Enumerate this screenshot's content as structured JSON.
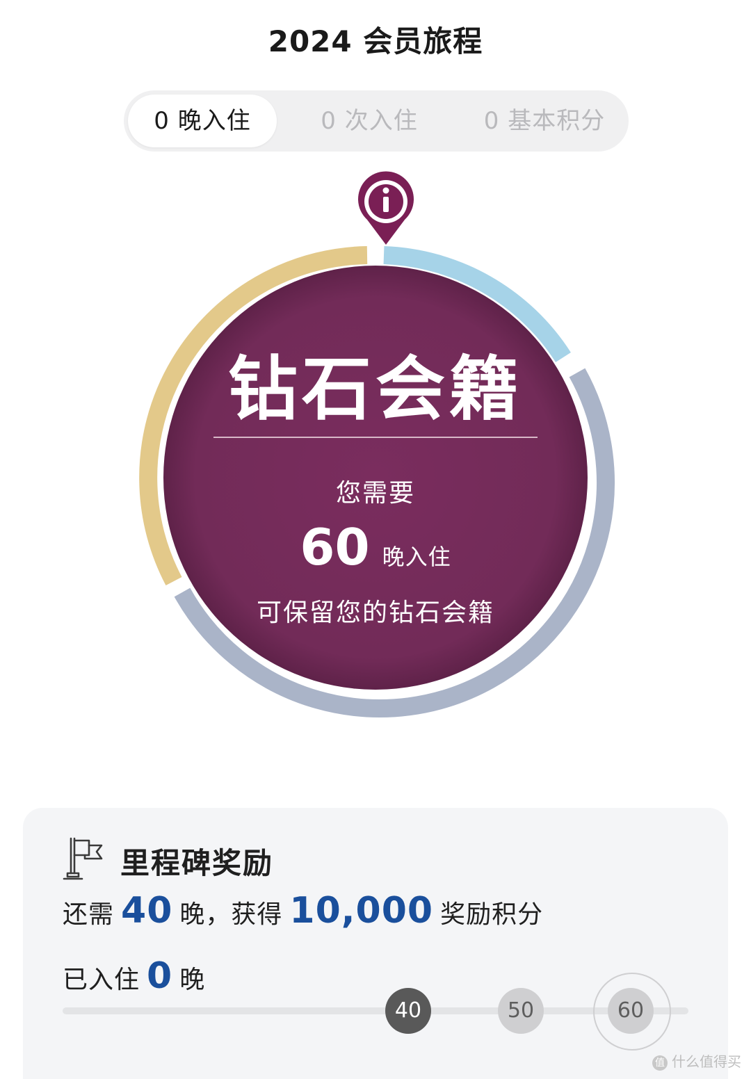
{
  "header": {
    "title": "2024 会员旅程"
  },
  "tabs": [
    {
      "label": "0 晚入住",
      "active": true
    },
    {
      "label": "0 次入住",
      "active": false
    },
    {
      "label": "0 基本积分",
      "active": false
    }
  ],
  "status_ring": {
    "info_icon": "info-pin-icon",
    "tier_name": "钻石会籍",
    "you_need": "您需要",
    "nights_needed": "60",
    "nights_unit": "晚入住",
    "retain_text": "可保留您的钻石会籍",
    "colors": {
      "center": "#722b58",
      "gold": "#e3c98a",
      "light_blue": "#a6d3e8",
      "slate": "#aab4c8",
      "pin": "#7a1f55"
    }
  },
  "milestone": {
    "icon": "flag-icon",
    "title": "里程碑奖励",
    "remaining_prefix": "还需",
    "remaining_nights": "40",
    "remaining_mid": "晚，获得",
    "reward_points": "10,000",
    "remaining_suffix": "奖励积分",
    "stayed_prefix": "已入住",
    "stayed_nights": "0",
    "stayed_suffix": "晚",
    "markers": [
      "40",
      "50",
      "60"
    ],
    "accent_color": "#1a4f9c"
  },
  "watermark": {
    "badge": "值",
    "text": "什么值得买"
  }
}
